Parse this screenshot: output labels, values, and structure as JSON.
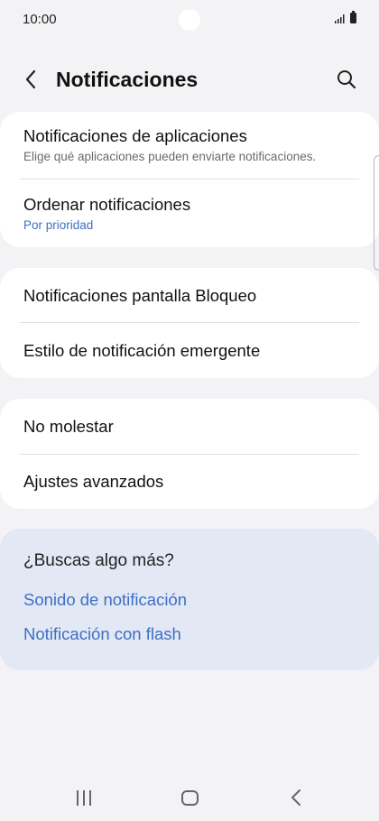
{
  "status_bar": {
    "time": "10:00"
  },
  "header": {
    "title": "Notificaciones"
  },
  "group1": {
    "app_notifications": {
      "title": "Notificaciones de aplicaciones",
      "subtitle": "Elige qué aplicaciones pueden enviarte notificaciones."
    },
    "sort_notifications": {
      "title": "Ordenar notificaciones",
      "value": "Por prioridad"
    }
  },
  "group2": {
    "lock_screen": {
      "title": "Notificaciones pantalla Bloqueo"
    },
    "popup_style": {
      "title": "Estilo de notificación emergente"
    }
  },
  "group3": {
    "do_not_disturb": {
      "title": "No molestar"
    },
    "advanced": {
      "title": "Ajustes avanzados"
    }
  },
  "suggestions": {
    "title": "¿Buscas algo más?",
    "links": [
      "Sonido de notificación",
      "Notificación con flash"
    ]
  },
  "colors": {
    "background": "#f3f3f5",
    "card": "#ffffff",
    "suggest_card": "#e3e8f5",
    "link_blue": "#3e6fc4"
  }
}
